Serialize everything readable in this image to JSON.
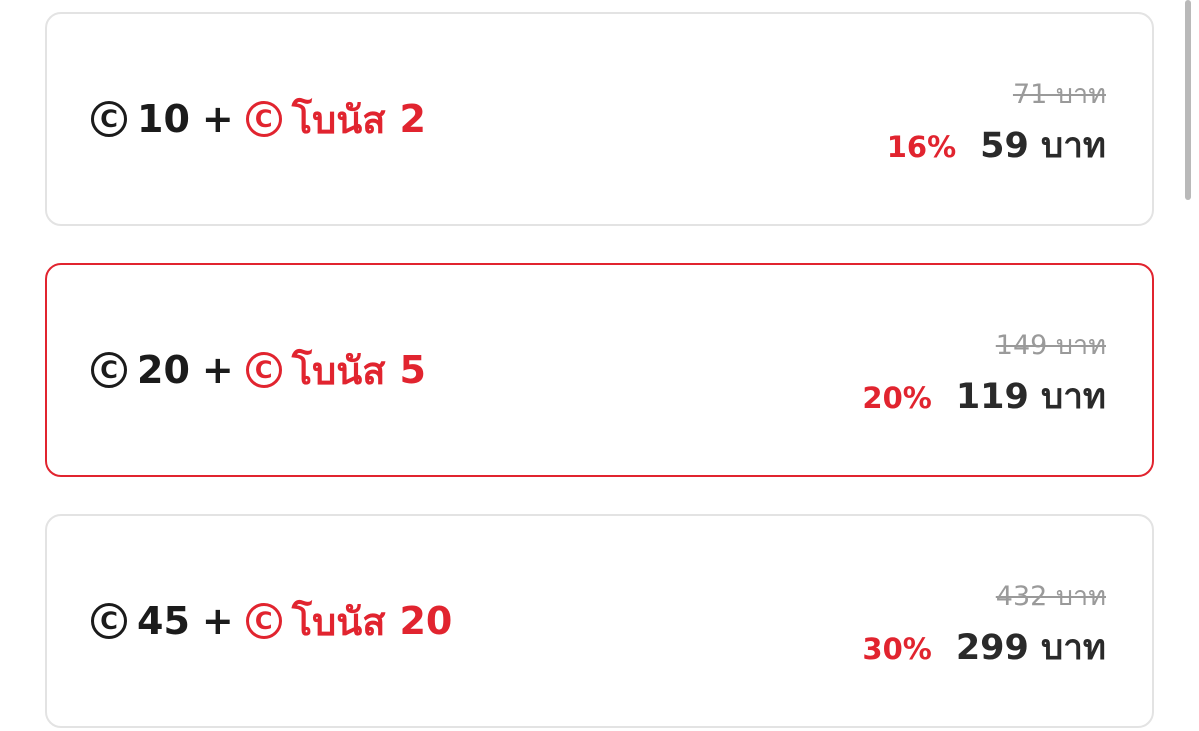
{
  "packages": [
    {
      "coin_amount": "10",
      "plus": "+",
      "bonus_label": "โบนัส",
      "bonus_amount": "2",
      "original_price": "71 บาท",
      "discount": "16%",
      "price": "59 บาท",
      "selected": false
    },
    {
      "coin_amount": "20",
      "plus": "+",
      "bonus_label": "โบนัส",
      "bonus_amount": "5",
      "original_price": "149 บาท",
      "discount": "20%",
      "price": "119 บาท",
      "selected": true
    },
    {
      "coin_amount": "45",
      "plus": "+",
      "bonus_label": "โบนัส",
      "bonus_amount": "20",
      "original_price": "432 บาท",
      "discount": "30%",
      "price": "299 บาท",
      "selected": false
    }
  ],
  "icons": {
    "coin_glyph": "C",
    "coin_color": "#1b1b1b",
    "bonus_coin_color": "#e1242f"
  },
  "colors": {
    "accent": "#e1242f",
    "card_border": "#e3e3e3",
    "strike_text": "#9a9a9a"
  }
}
